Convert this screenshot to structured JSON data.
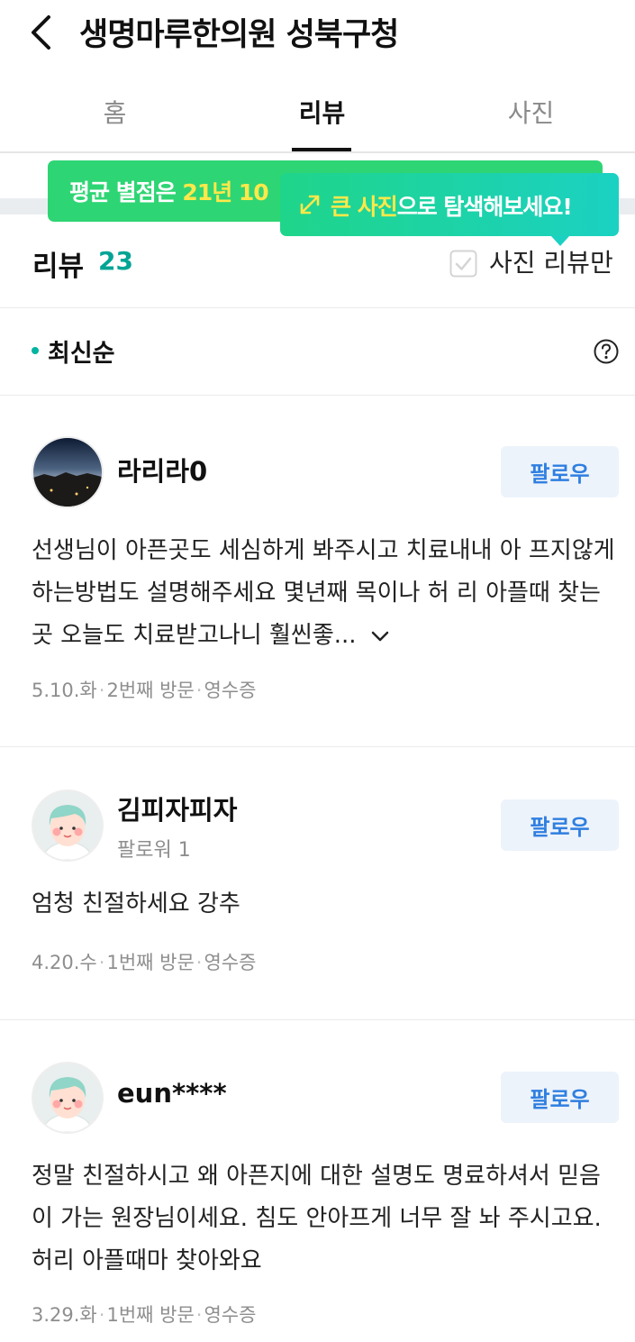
{
  "header": {
    "title": "생명마루한의원 성북구청"
  },
  "tabs": [
    {
      "label": "홈"
    },
    {
      "label": "리뷰"
    },
    {
      "label": "사진"
    }
  ],
  "tooltips": {
    "rating": {
      "prefix": "평균 별점은 ",
      "highlight": "21년 10"
    },
    "photo": {
      "highlight": "큰 사진",
      "suffix": "으로 탐색해보세요!"
    }
  },
  "reviews_header": {
    "title": "리뷰",
    "count": "23",
    "photo_only_label": "사진 리뷰만"
  },
  "sort": {
    "label": "최신순"
  },
  "reviews": [
    {
      "name": "라리라0",
      "follow_label": "팔로우",
      "text": "선생님이 아픈곳도 세심하게 봐주시고 치료내내 아 프지않게하는방법도 설명해주세요 몇년째 목이나 허 리 아플때 찾는곳 오늘도 치료받고나니 훨씬좋...",
      "date": "5.10.화",
      "visit": "2번째 방문",
      "proof": "영수증"
    },
    {
      "name": "김피자피자",
      "followers": "팔로워 1",
      "follow_label": "팔로우",
      "text": "엄청 친절하세요 강추",
      "date": "4.20.수",
      "visit": "1번째 방문",
      "proof": "영수증"
    },
    {
      "name": "eun****",
      "follow_label": "팔로우",
      "text": "정말 친절하시고 왜 아픈지에 대한 설명도 명료하셔서 믿음이 가는 원장님이세요. 침도 안아프게 너무 잘 놔 주시고요. 허리 아플때마 찾아와요",
      "date": "3.29.화",
      "visit": "1번째 방문",
      "proof": "영수증"
    }
  ],
  "colors": {
    "accent": "#00a495",
    "follow_button_bg": "#edf3fb",
    "follow_button_text": "#2f7fe0",
    "tooltip_green": "#2ed574"
  },
  "icons": [
    "back-icon",
    "expand-icon",
    "checkbox-icon",
    "help-icon",
    "chevron-down-icon"
  ]
}
